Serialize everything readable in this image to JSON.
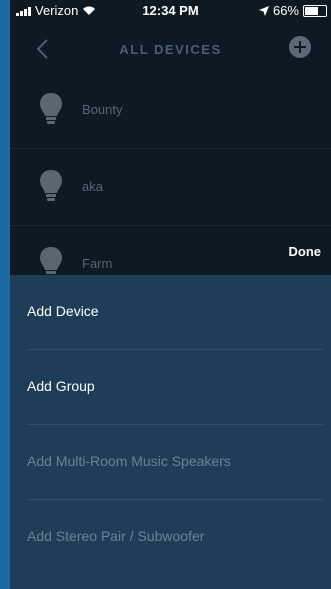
{
  "status_bar": {
    "carrier": "Verizon",
    "time": "12:34 PM",
    "battery": "66%"
  },
  "header": {
    "title": "ALL DEVICES"
  },
  "devices": [
    {
      "name": "Bounty"
    },
    {
      "name": "aka"
    },
    {
      "name": "Farm"
    }
  ],
  "done_label": "Done",
  "action_sheet": {
    "items": [
      {
        "label": "Add Device",
        "enabled": true
      },
      {
        "label": "Add Group",
        "enabled": true
      },
      {
        "label": "Add Multi-Room Music Speakers",
        "enabled": false
      },
      {
        "label": "Add Stereo Pair / Subwoofer",
        "enabled": false
      }
    ]
  },
  "colors": {
    "background": "#0e1a23",
    "sheet": "#1e3d59",
    "desktop": "#1a6aa4"
  }
}
